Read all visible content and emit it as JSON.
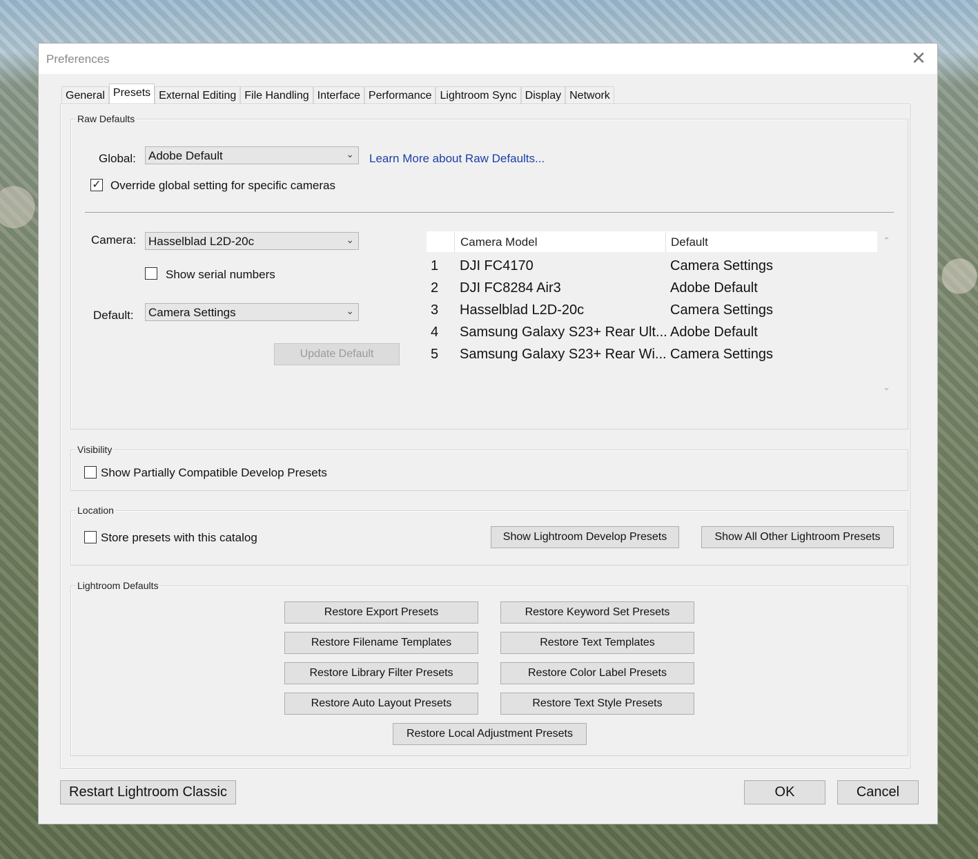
{
  "window": {
    "title": "Preferences",
    "close_glyph": "✕"
  },
  "tabs": [
    "General",
    "Presets",
    "External Editing",
    "File Handling",
    "Interface",
    "Performance",
    "Lightroom Sync",
    "Display",
    "Network"
  ],
  "active_tab": "Presets",
  "raw_defaults": {
    "section_label": "Raw Defaults",
    "global_label": "Global:",
    "global_value": "Adobe Default",
    "learn_more": "Learn More about Raw Defaults...",
    "override_label": "Override global setting for specific cameras",
    "override_checked": true,
    "camera_label": "Camera:",
    "camera_value": "Hasselblad L2D-20c",
    "serial_label": "Show serial numbers",
    "serial_checked": false,
    "default_label": "Default:",
    "default_value": "Camera Settings",
    "update_button": "Update Default",
    "table": {
      "headers": [
        "Camera Model",
        "Default"
      ],
      "rows": [
        {
          "n": "1",
          "model": "DJI FC4170",
          "default": "Camera Settings"
        },
        {
          "n": "2",
          "model": "DJI FC8284 Air3",
          "default": "Adobe Default"
        },
        {
          "n": "3",
          "model": "Hasselblad L2D-20c",
          "default": "Camera Settings"
        },
        {
          "n": "4",
          "model": "Samsung Galaxy S23+ Rear Ult...",
          "default": "Adobe Default"
        },
        {
          "n": "5",
          "model": "Samsung Galaxy S23+ Rear Wi...",
          "default": "Camera Settings"
        }
      ]
    }
  },
  "visibility": {
    "section_label": "Visibility",
    "partial_label": "Show Partially Compatible Develop Presets",
    "partial_checked": false
  },
  "location": {
    "section_label": "Location",
    "store_label": "Store presets with this catalog",
    "store_checked": false,
    "show_develop": "Show Lightroom Develop Presets",
    "show_other": "Show All Other Lightroom Presets"
  },
  "lightroom_defaults": {
    "section_label": "Lightroom Defaults",
    "buttons": [
      "Restore Export Presets",
      "Restore Keyword Set Presets",
      "Restore Filename Templates",
      "Restore Text Templates",
      "Restore Library Filter Presets",
      "Restore Color Label Presets",
      "Restore Auto Layout Presets",
      "Restore Text Style Presets",
      "Restore Local Adjustment Presets"
    ]
  },
  "footer": {
    "restart": "Restart Lightroom Classic",
    "ok": "OK",
    "cancel": "Cancel"
  },
  "icons": {
    "chevron": "chevron-down-icon",
    "check": "checkmark-icon",
    "close": "close-icon"
  }
}
